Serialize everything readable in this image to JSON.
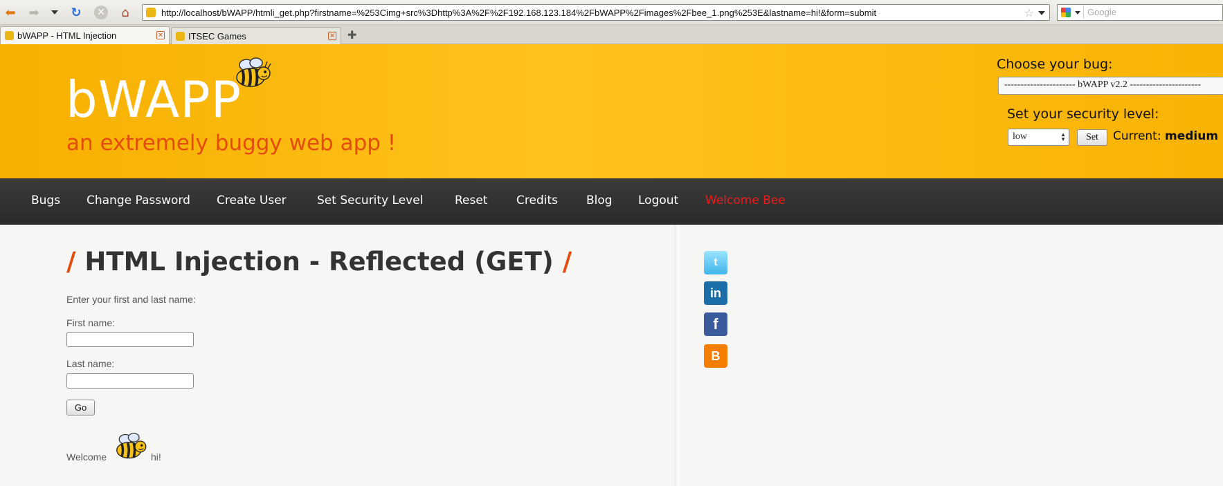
{
  "browser": {
    "url": "http://localhost/bWAPP/htmli_get.php?firstname=%253Cimg+src%3Dhttp%3A%2F%2F192.168.123.184%2FbWAPP%2Fimages%2Fbee_1.png%253E&lastname=hi!&form=submit",
    "search_placeholder": "Google",
    "tabs": [
      {
        "label": "bWAPP - HTML Injection"
      },
      {
        "label": "ITSEC Games"
      }
    ]
  },
  "header": {
    "logo": "bWAPP",
    "tagline": "an extremely buggy web app !",
    "choose_bug_label": "Choose your bug:",
    "bug_selected": "---------------------- bWAPP v2.2 ----------------------",
    "security_label": "Set your security level:",
    "security_selected": "low",
    "set_button": "Set",
    "current_label": "Current:",
    "current_value": "medium"
  },
  "nav": {
    "items": [
      "Bugs",
      "Change Password",
      "Create User",
      "Set Security Level",
      "Reset",
      "Credits",
      "Blog",
      "Logout"
    ],
    "welcome": "Welcome Bee"
  },
  "main": {
    "title": "HTML Injection - Reflected (GET)",
    "instruction": "Enter your first and last name:",
    "first_name_label": "First name:",
    "first_name_value": "",
    "last_name_label": "Last name:",
    "last_name_value": "",
    "go_button": "Go",
    "result_prefix": "Welcome",
    "result_suffix": "hi!"
  },
  "social": [
    "twitter-icon",
    "linkedin-icon",
    "facebook-icon",
    "blogger-icon"
  ],
  "colors": {
    "header_bg": "#ffc21d",
    "tagline": "#e44c0e",
    "nav_bg": "#2f2f2f",
    "welcome": "#ee1b1b"
  }
}
